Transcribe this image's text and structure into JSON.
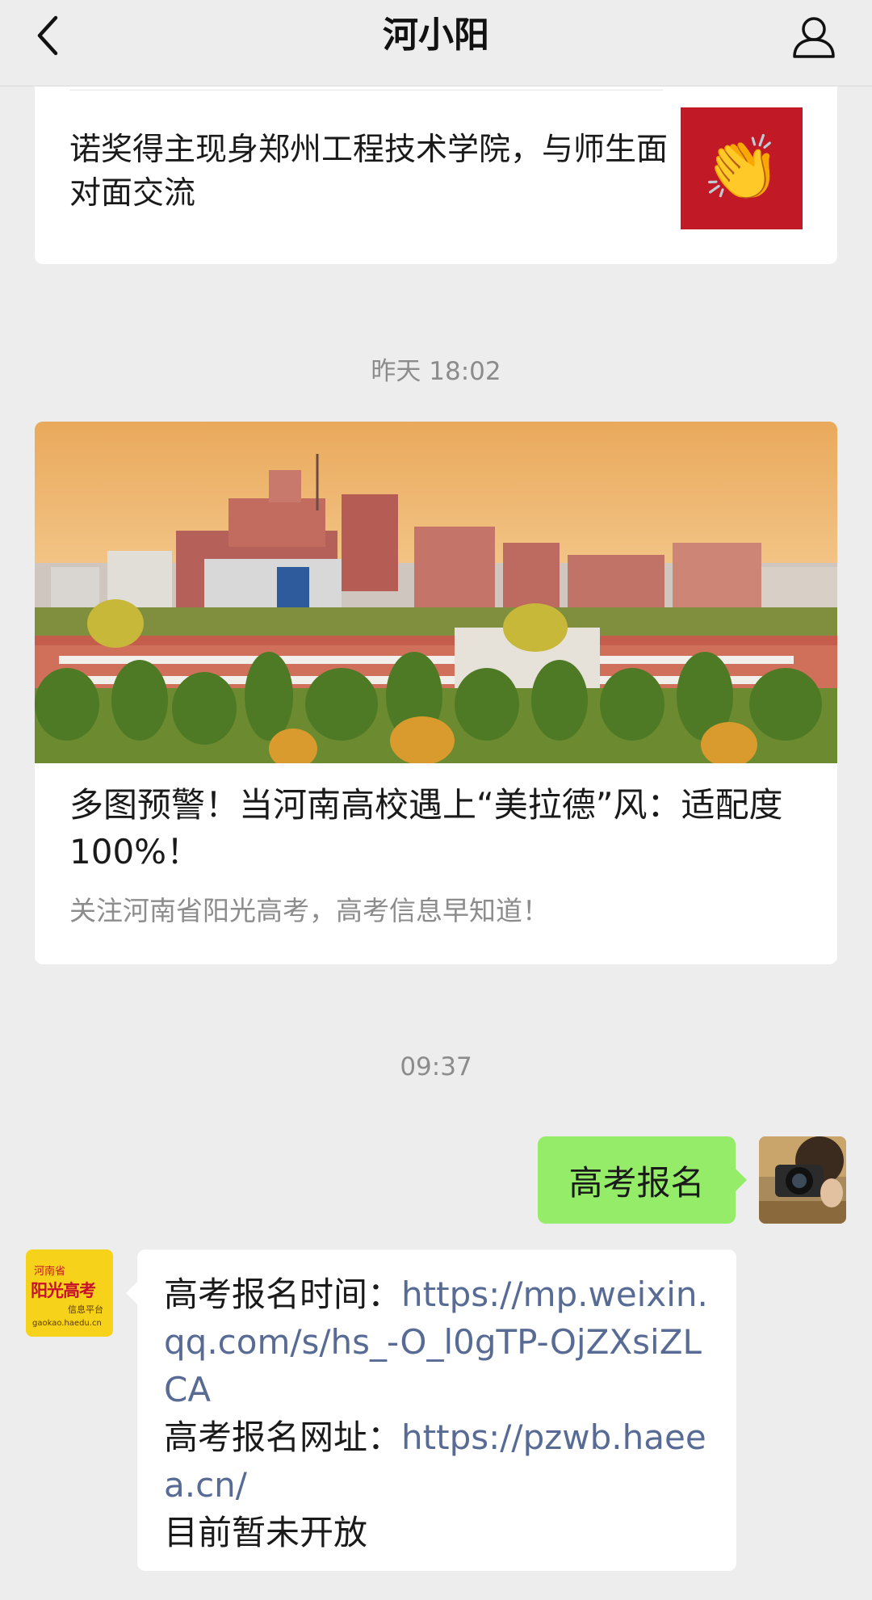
{
  "navbar": {
    "title": "河小阳",
    "back_icon": "chevron-left-icon",
    "profile_icon": "person-icon"
  },
  "articles": [
    {
      "title": "诺奖得主现身郑州工程技术学院，与师生面对面交流",
      "thumbnail_icon": "clapping-hands-icon",
      "thumbnail_emoji": "👏",
      "thumbnail_bg": "#c21927"
    },
    {
      "timestamp": "昨天 18:02",
      "title": "多图预警！当河南高校遇上“美拉德”风：适配度100%！",
      "summary": "关注河南省阳光高考，高考信息早知道！"
    }
  ],
  "chat": {
    "timestamp": "09:37",
    "outgoing": {
      "text": "高考报名",
      "bubble_color": "#95ec69"
    },
    "incoming": {
      "label1": "高考报名时间：",
      "link1": "https://mp.weixin.qq.com/s/hs_-O_l0gTP-OjZXsiZLCA",
      "label2": "高考报名网址：",
      "link2": "https://pzwb.haeea.cn/",
      "note": "目前暂未开放",
      "link_color": "#576b95"
    },
    "bot_avatar": {
      "line1": "河南省",
      "line2": "阳光高考",
      "line3": "信息平台",
      "line4": "gaokao.haedu.cn"
    }
  }
}
